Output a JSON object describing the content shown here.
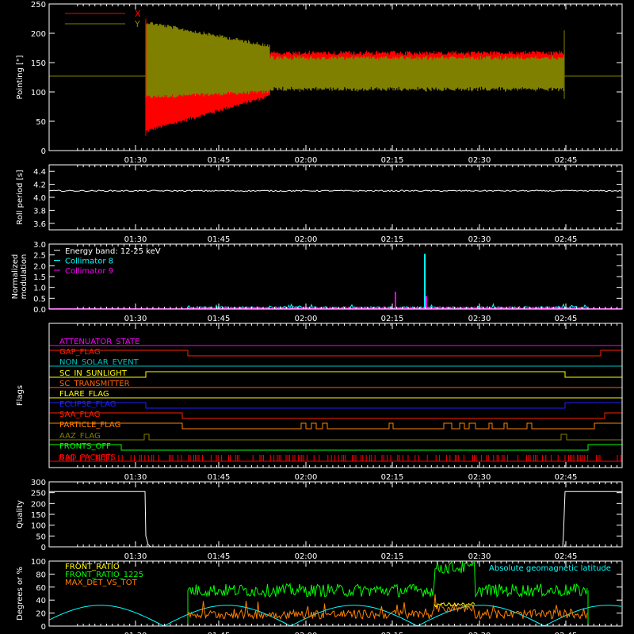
{
  "chart_data": [
    {
      "type": "line",
      "ylabel": "Pointing [\"]",
      "ylim": [
        0,
        250
      ],
      "yticks": [
        0,
        50,
        100,
        150,
        200,
        250
      ],
      "xticks": [
        "01:30",
        "01:45",
        "02:00",
        "02:15",
        "02:30",
        "02:45"
      ],
      "legend_position": "top-left",
      "series": [
        {
          "name": "X",
          "color": "#ff0000"
        },
        {
          "name": "Y",
          "color": "#808000"
        }
      ]
    },
    {
      "type": "line",
      "ylabel": "Roll period [s]",
      "ylim": [
        3.5,
        4.5
      ],
      "yticks": [
        "3.6",
        "3.8",
        "4.0",
        "4.2",
        "4.4"
      ],
      "xticks": [
        "01:30",
        "01:45",
        "02:00",
        "02:15",
        "02:30",
        "02:45"
      ],
      "series": [
        {
          "color": "#ffffff",
          "values": [
            4.1
          ]
        }
      ]
    },
    {
      "type": "line",
      "ylabel": [
        "Normalized",
        "modulation"
      ],
      "ylim": [
        0,
        3
      ],
      "yticks": [
        "0.0",
        "0.5",
        "1.0",
        "1.5",
        "2.0",
        "2.5",
        "3.0"
      ],
      "xticks": [
        "01:30",
        "01:45",
        "02:00",
        "02:15",
        "02:30",
        "02:45"
      ],
      "legend_position": "top-left",
      "series": [
        {
          "name": "Energy band: 12-25 keV",
          "color": "#ffffff"
        },
        {
          "name": "Collimator 8",
          "color": "#00ffff"
        },
        {
          "name": "Collimator 9",
          "color": "#ff00ff"
        }
      ]
    },
    {
      "type": "line",
      "ylabel": "Flags",
      "xticks": [
        "01:30",
        "01:45",
        "02:00",
        "02:15",
        "02:30",
        "02:45"
      ],
      "series": [
        {
          "name": "ATTENUATOR_STATE",
          "color": "#ff00ff"
        },
        {
          "name": "GAP_FLAG",
          "color": "#ff2000"
        },
        {
          "name": "NON_SOLAR_EVENT",
          "color": "#00c0c0"
        },
        {
          "name": "SC_IN_SUNLIGHT",
          "color": "#ffff00"
        },
        {
          "name": "SC_TRANSMITTER",
          "color": "#ff6000"
        },
        {
          "name": "FLARE_FLAG",
          "color": "#ffff00"
        },
        {
          "name": "ECLIPSE_FLAG",
          "color": "#2020ff"
        },
        {
          "name": "SAA_FLAG",
          "color": "#ff2000"
        },
        {
          "name": "PARTICLE_FLAG",
          "color": "#ff8000"
        },
        {
          "name": "AAZ_FLAG",
          "color": "#808000"
        },
        {
          "name": "FRONTS_OFF",
          "color": "#00ff00"
        },
        {
          "name": "BAD_PACKETS",
          "color": "#ff0000"
        }
      ]
    },
    {
      "type": "line",
      "ylabel": "Quality",
      "ylim": [
        0,
        300
      ],
      "yticks": [
        0,
        50,
        100,
        150,
        200,
        250,
        300
      ],
      "xticks": [
        "01:30",
        "01:45",
        "02:00",
        "02:15",
        "02:30",
        "02:45"
      ],
      "series": [
        {
          "color": "#ffffff"
        }
      ]
    },
    {
      "type": "line",
      "ylabel": "Degrees or %",
      "ylim": [
        0,
        100
      ],
      "yticks": [
        0,
        20,
        40,
        60,
        80,
        100
      ],
      "xticks": [
        "01:30",
        "01:45",
        "02:00",
        "02:15",
        "02:30",
        "02:45"
      ],
      "annotation": "Absolute geomagnetic latitude",
      "annotation_color": "#00ffff",
      "series": [
        {
          "name": "FRONT_RATIO",
          "color": "#ffff00"
        },
        {
          "name": "FRONT_RATIO_1225",
          "color": "#00ff00"
        },
        {
          "name": "MAX_DET_VS_TOT",
          "color": "#ff8000"
        }
      ]
    }
  ]
}
